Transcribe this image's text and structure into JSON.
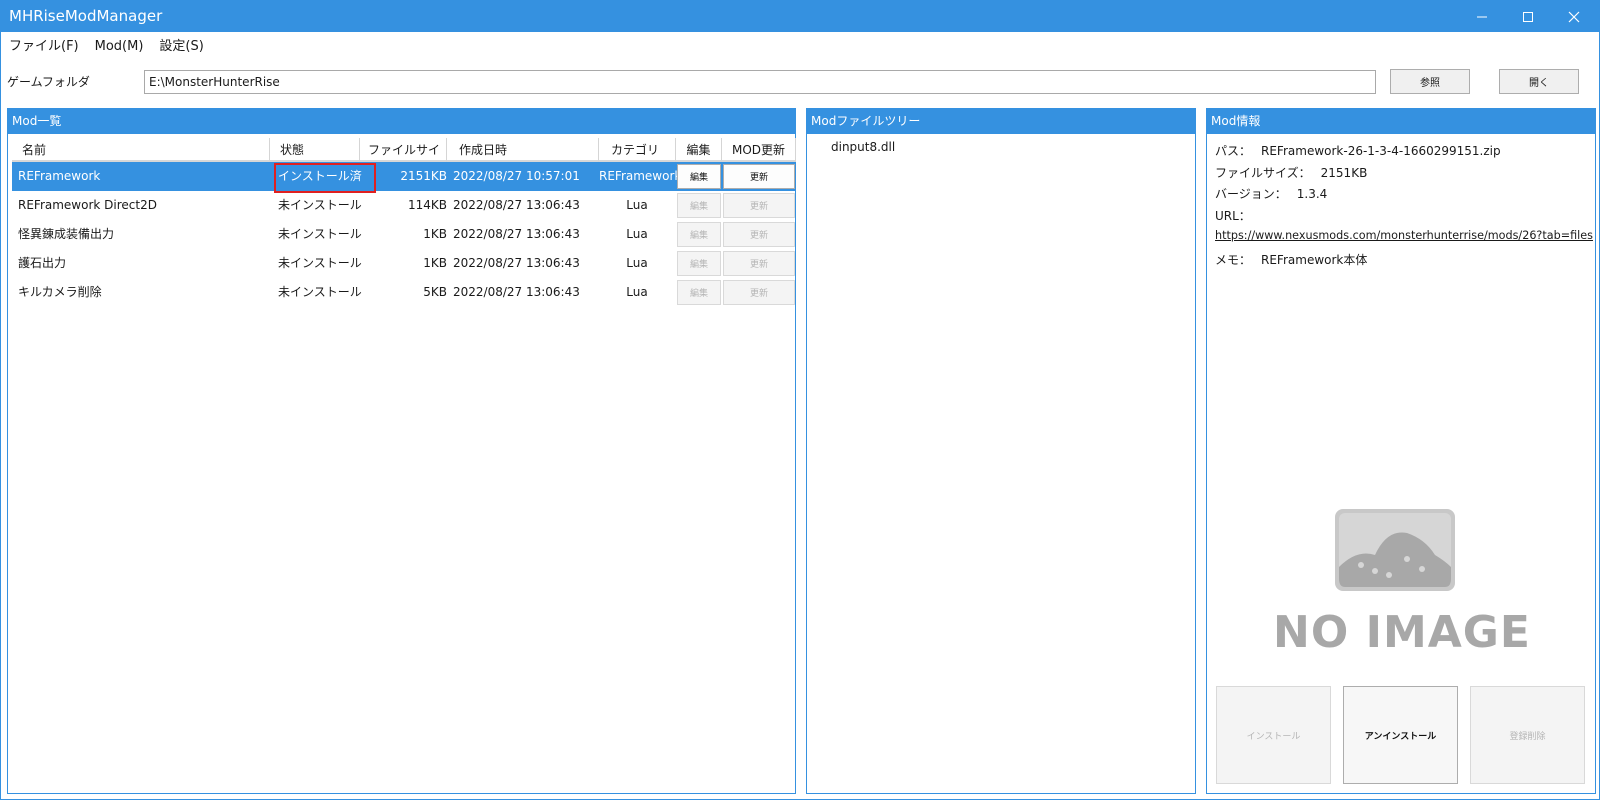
{
  "app": {
    "title": "MHRiseModManager"
  },
  "menu": [
    {
      "label": "ファイル(F)"
    },
    {
      "label": "Mod(M)"
    },
    {
      "label": "設定(S)"
    }
  ],
  "folder": {
    "label": "ゲームフォルダ",
    "value": "E:\\MonsterHunterRise",
    "browse_label": "参照",
    "open_label": "開く"
  },
  "mod_list": {
    "title": "Mod一覧",
    "columns": [
      "名前",
      "状態",
      "ファイルサイズ",
      "作成日時",
      "カテゴリ",
      "編集",
      "MOD更新"
    ],
    "rows": [
      {
        "name": "REFramework",
        "state": "インストール済",
        "size": "2151KB",
        "created": "2022/08/27 10:57:01",
        "category": "REFramework",
        "edit": "編集",
        "update": "更新"
      },
      {
        "name": "REFramework Direct2D",
        "state": "未インストール",
        "size": "114KB",
        "created": "2022/08/27 13:06:43",
        "category": "Lua",
        "edit": "編集",
        "update": "更新"
      },
      {
        "name": "怪異錬成装備出力",
        "state": "未インストール",
        "size": "1KB",
        "created": "2022/08/27 13:06:43",
        "category": "Lua",
        "edit": "編集",
        "update": "更新"
      },
      {
        "name": "護石出力",
        "state": "未インストール",
        "size": "1KB",
        "created": "2022/08/27 13:06:43",
        "category": "Lua",
        "edit": "編集",
        "update": "更新"
      },
      {
        "name": "キルカメラ削除",
        "state": "未インストール",
        "size": "5KB",
        "created": "2022/08/27 13:06:43",
        "category": "Lua",
        "edit": "編集",
        "update": "更新"
      }
    ]
  },
  "file_tree": {
    "title": "Modファイルツリー",
    "items": [
      "dinput8.dll"
    ]
  },
  "mod_info": {
    "title": "Mod情報",
    "path_label": "パス：",
    "path_value": "REFramework-26-1-3-4-1660299151.zip",
    "size_label": "ファイルサイズ：",
    "size_value": "2151KB",
    "version_label": "バージョン：",
    "version_value": "1.3.4",
    "url_label": "URL：",
    "url_value": "https://www.nexusmods.com/monsterhunterrise/mods/26?tab=files",
    "memo_label": "メモ：",
    "memo_value": "REFramework本体",
    "image_text": "NO IMAGE",
    "install_label": "インストール",
    "uninstall_label": "アンインストール",
    "delete_label": "登録削除"
  },
  "colors": {
    "accent": "#3591e0",
    "highlight_border": "#e02020"
  }
}
